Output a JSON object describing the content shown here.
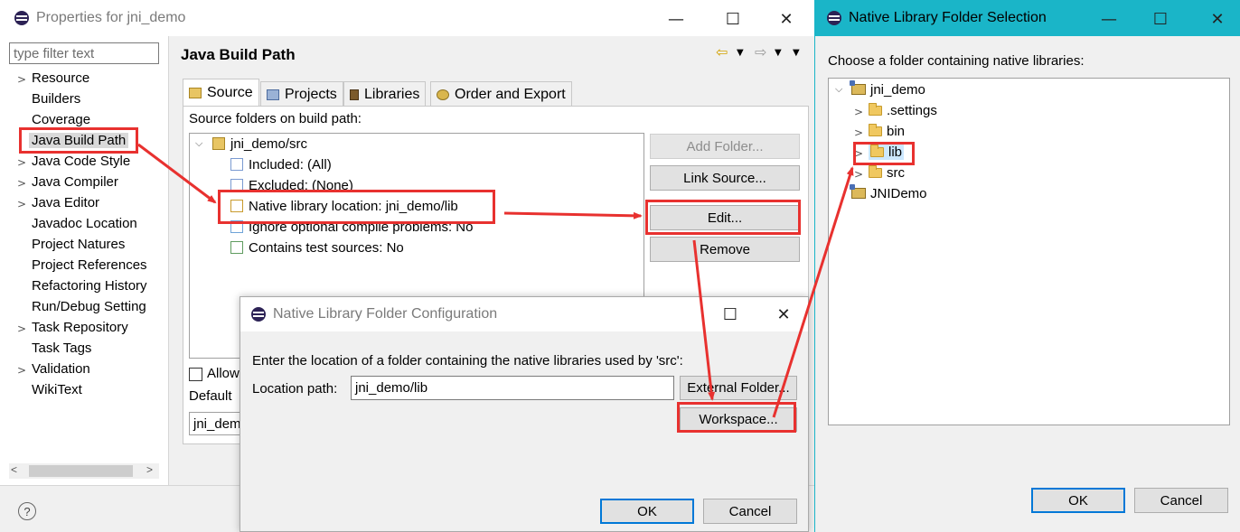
{
  "properties": {
    "title": "Properties for jni_demo",
    "filter_placeholder": "type filter text",
    "nav": [
      {
        "label": "Resource",
        "expandable": true
      },
      {
        "label": "Builders",
        "expandable": false
      },
      {
        "label": "Coverage",
        "expandable": false
      },
      {
        "label": "Java Build Path",
        "expandable": false,
        "selected": true
      },
      {
        "label": "Java Code Style",
        "expandable": true
      },
      {
        "label": "Java Compiler",
        "expandable": true
      },
      {
        "label": "Java Editor",
        "expandable": true
      },
      {
        "label": "Javadoc Location",
        "expandable": false
      },
      {
        "label": "Project Natures",
        "expandable": false
      },
      {
        "label": "Project References",
        "expandable": false
      },
      {
        "label": "Refactoring History",
        "expandable": false
      },
      {
        "label": "Run/Debug Setting",
        "expandable": false
      },
      {
        "label": "Task Repository",
        "expandable": true
      },
      {
        "label": "Task Tags",
        "expandable": false
      },
      {
        "label": "Validation",
        "expandable": true
      },
      {
        "label": "WikiText",
        "expandable": false
      }
    ],
    "page_title": "Java Build Path",
    "tabs": [
      "Source",
      "Projects",
      "Libraries",
      "Order and Export"
    ],
    "source_label": "Source folders on build path:",
    "tree": {
      "root": "jni_demo/src",
      "children": [
        "Included: (All)",
        "Excluded: (None)",
        "Native library location: jni_demo/lib",
        "Ignore optional compile problems: No",
        "Contains test sources: No"
      ]
    },
    "buttons": {
      "add_folder": "Add Folder...",
      "link_source": "Link Source...",
      "edit": "Edit...",
      "remove": "Remove"
    },
    "allow_label": "Allow",
    "default_label": "Default",
    "default_value": "jni_dem",
    "help_glyph": "?"
  },
  "config_dialog": {
    "title": "Native Library Folder Configuration",
    "prompt": "Enter the location of a folder containing the native libraries used by 'src':",
    "location_label": "Location path:",
    "location_value": "jni_demo/lib",
    "external_button": "External Folder...",
    "workspace_button": "Workspace...",
    "ok": "OK",
    "cancel": "Cancel"
  },
  "selection_dialog": {
    "title": "Native Library Folder Selection",
    "prompt": "Choose a folder containing native libraries:",
    "tree": {
      "root": "jni_demo",
      "children": [
        ".settings",
        "bin",
        "lib",
        "src"
      ],
      "selected": "lib",
      "other_project": "JNIDemo"
    },
    "ok": "OK",
    "cancel": "Cancel"
  },
  "colors": {
    "annotation": "#e8312f",
    "selection_title_bar": "#1ab5c8",
    "selection_highlight": "#cce8ff",
    "nav_selected": "#d9d9d9"
  }
}
